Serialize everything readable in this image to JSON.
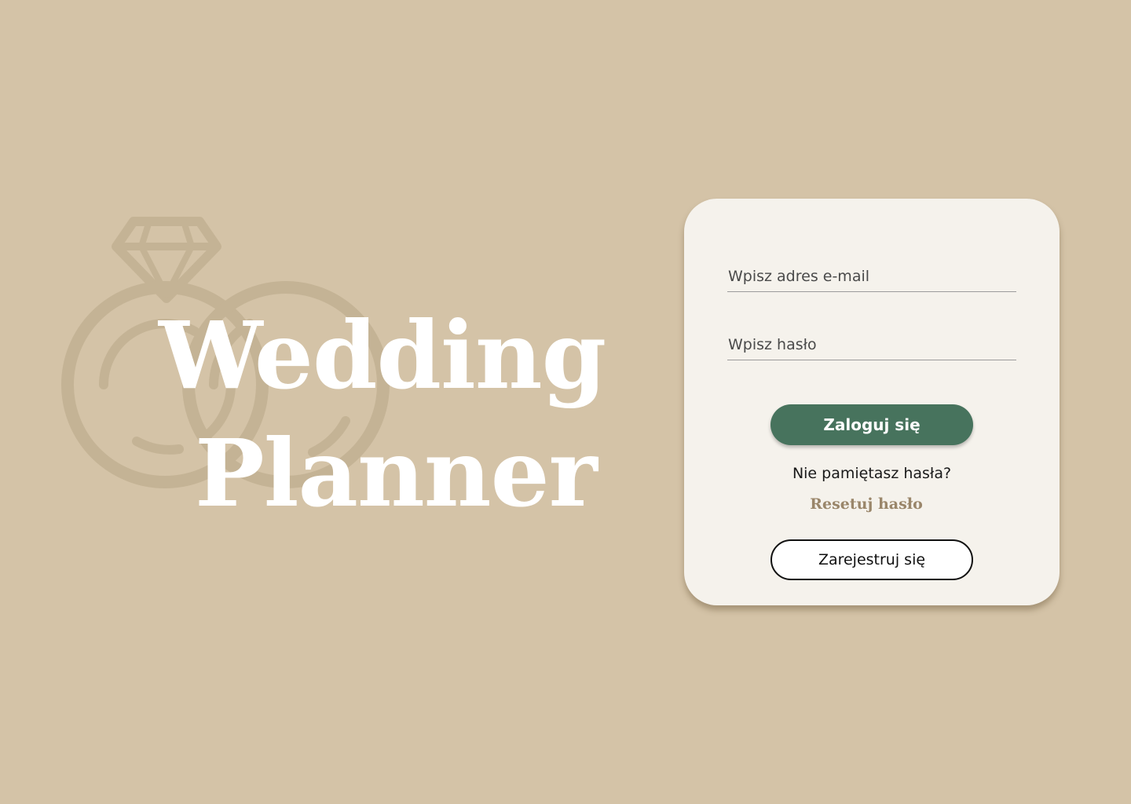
{
  "brand": {
    "line1": "Wedding",
    "line2": "Planner"
  },
  "login": {
    "email_placeholder": "Wpisz adres e-mail",
    "password_placeholder": "Wpisz hasło",
    "login_label": "Zaloguj się",
    "forgot_text": "Nie pamiętasz hasła?",
    "reset_label": "Resetuj hasło",
    "register_label": "Zarejestruj się"
  },
  "colors": {
    "background": "#d4c3a7",
    "card": "#f5f2ec",
    "accent_green": "#47735d",
    "accent_tan": "#9a866a"
  },
  "icons": {
    "background_logo": "wedding-rings-icon"
  }
}
